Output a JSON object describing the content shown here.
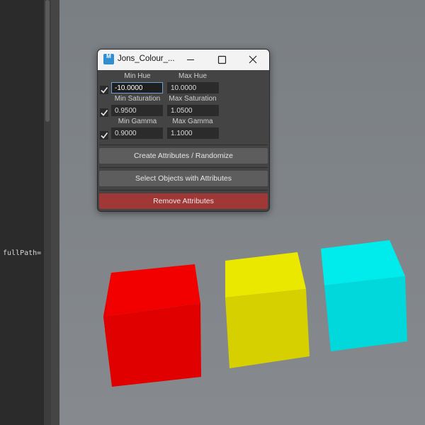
{
  "script_editor": {
    "code_snippet": "fullPath="
  },
  "window": {
    "title": "Jons_Colour_...",
    "icon_letter": "M",
    "controls": [
      "minimize-icon",
      "maximize-icon",
      "close-icon"
    ]
  },
  "fields": {
    "hue": {
      "label_min": "Min Hue",
      "label_max": "Max Hue",
      "min": "-10.0000",
      "max": "10.0000",
      "checked": true
    },
    "saturation": {
      "label_min": "Min Saturation",
      "label_max": "Max Saturation",
      "min": "0.9500",
      "max": "1.0500",
      "checked": true
    },
    "gamma": {
      "label_min": "Min Gamma",
      "label_max": "Max Gamma",
      "min": "0.9000",
      "max": "1.1000",
      "checked": true
    }
  },
  "buttons": {
    "create": "Create Attributes / Randomize",
    "select": "Select Objects with Attributes",
    "remove": "Remove Attributes"
  },
  "colors": {
    "remove_button": "#a03838",
    "cube_red": "#e00000",
    "cube_yellow": "#e6e000",
    "cube_cyan": "#00e4e4"
  }
}
